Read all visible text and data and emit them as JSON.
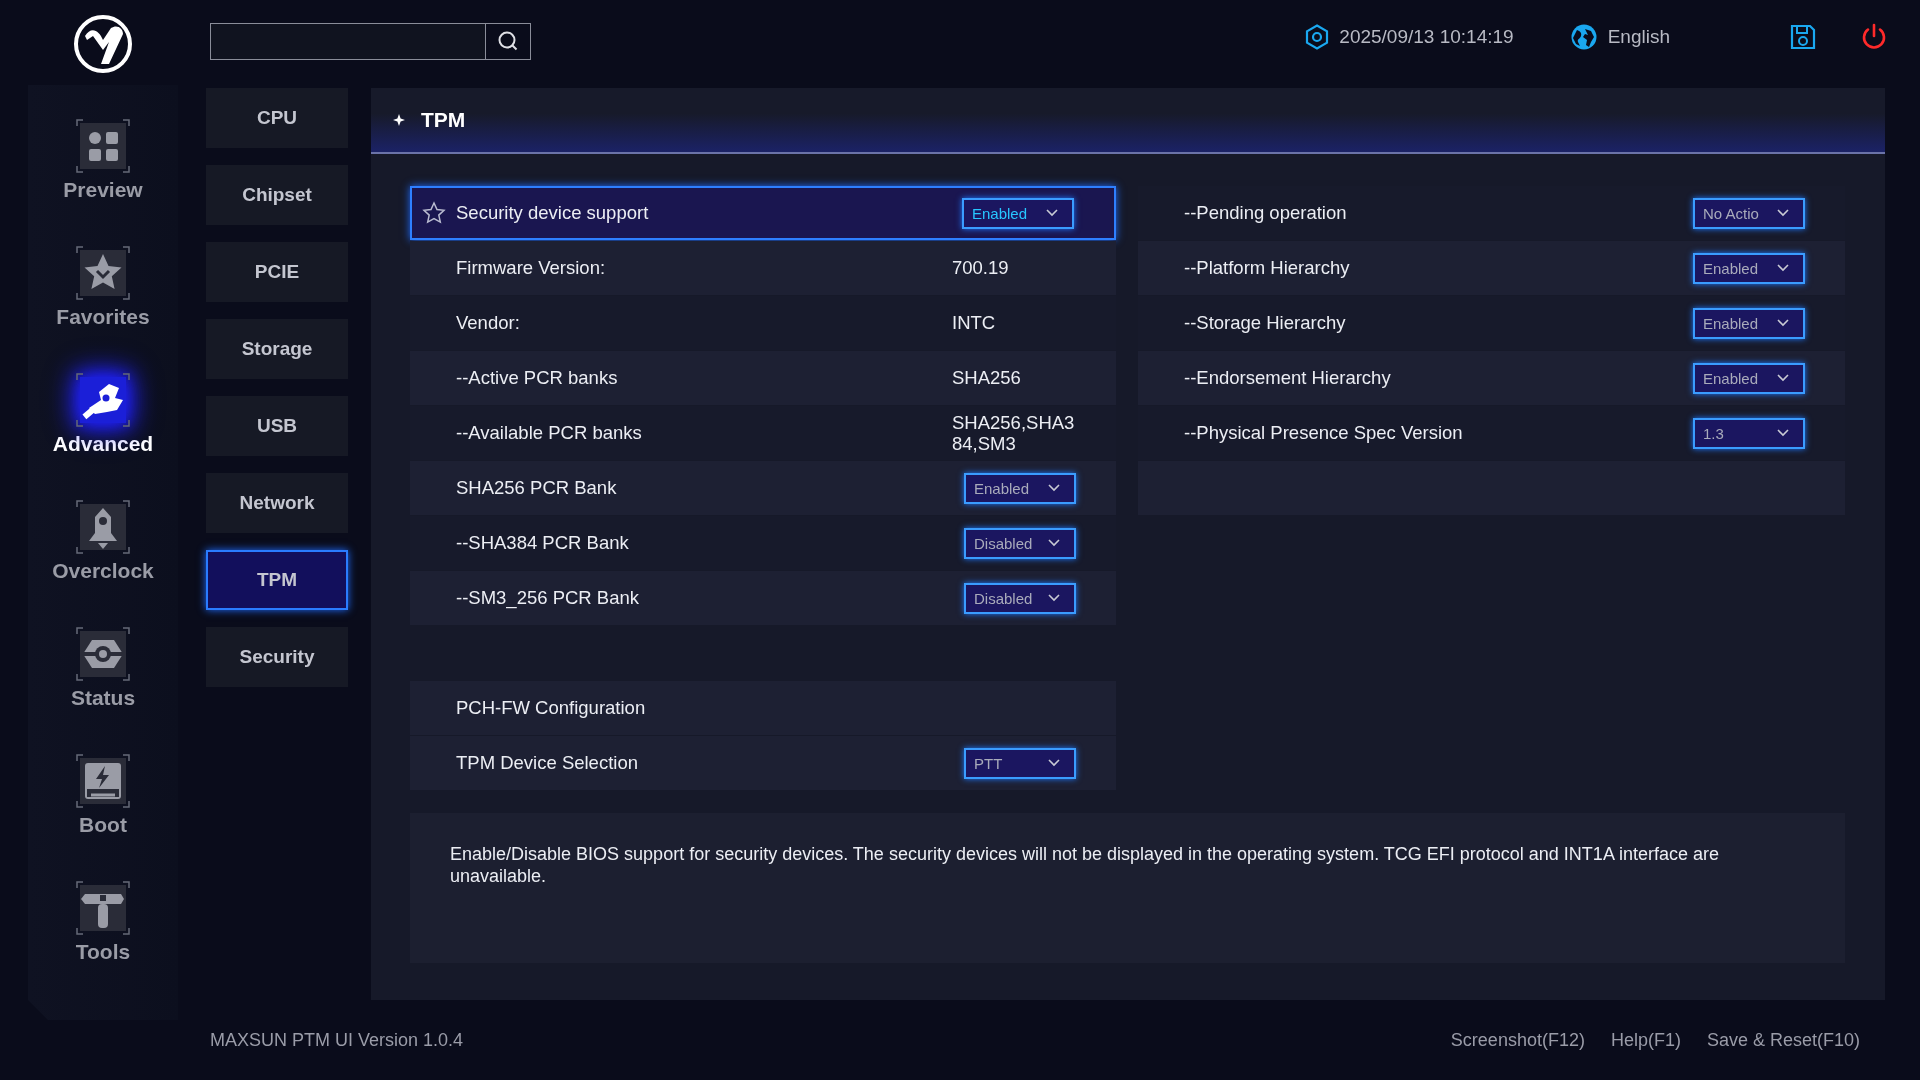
{
  "status_bar": {
    "datetime": "2025/09/13 10:14:19",
    "language": "English"
  },
  "nav": [
    {
      "label": "Preview",
      "selected": false
    },
    {
      "label": "Favorites",
      "selected": false
    },
    {
      "label": "Advanced",
      "selected": true
    },
    {
      "label": "Overclock",
      "selected": false
    },
    {
      "label": "Status",
      "selected": false
    },
    {
      "label": "Boot",
      "selected": false
    },
    {
      "label": "Tools",
      "selected": false
    }
  ],
  "submenu": [
    {
      "label": "CPU",
      "selected": false
    },
    {
      "label": "Chipset",
      "selected": false
    },
    {
      "label": "PCIE",
      "selected": false
    },
    {
      "label": "Storage",
      "selected": false
    },
    {
      "label": "USB",
      "selected": false
    },
    {
      "label": "Network",
      "selected": false
    },
    {
      "label": "TPM",
      "selected": true
    },
    {
      "label": "Security",
      "selected": false
    }
  ],
  "panel": {
    "title": "TPM",
    "left_sections": [
      {
        "rows": [
          {
            "kind": "select",
            "label": "Security device support",
            "value": "Enabled",
            "selected": true
          },
          {
            "kind": "info",
            "label": "Firmware Version:",
            "value": "700.19",
            "selected": false
          },
          {
            "kind": "info",
            "label": "Vendor:",
            "value": "INTC",
            "selected": false
          },
          {
            "kind": "info",
            "label": "--Active PCR banks",
            "value": "SHA256",
            "selected": false
          },
          {
            "kind": "info",
            "label": "--Available PCR banks",
            "value": "SHA256,SHA384,SM3",
            "selected": false
          },
          {
            "kind": "select",
            "label": "SHA256 PCR Bank",
            "value": "Enabled",
            "selected": false
          },
          {
            "kind": "select",
            "label": "--SHA384 PCR Bank",
            "value": "Disabled",
            "selected": false
          },
          {
            "kind": "select",
            "label": "--SM3_256 PCR Bank",
            "value": "Disabled",
            "selected": false
          }
        ]
      },
      {
        "rows": [
          {
            "kind": "heading",
            "label": "PCH-FW Configuration",
            "selected": false
          },
          {
            "kind": "select",
            "label": "TPM Device Selection",
            "value": "PTT",
            "selected": false
          }
        ]
      }
    ],
    "right_rows": [
      {
        "kind": "select",
        "label": "--Pending operation",
        "value": "No Actio",
        "selected": false
      },
      {
        "kind": "select",
        "label": "--Platform Hierarchy",
        "value": "Enabled",
        "selected": false
      },
      {
        "kind": "select",
        "label": "--Storage Hierarchy",
        "value": "Enabled",
        "selected": false
      },
      {
        "kind": "select",
        "label": "--Endorsement Hierarchy",
        "value": "Enabled",
        "selected": false
      },
      {
        "kind": "select",
        "label": "--Physical Presence Spec Version",
        "value": "1.3",
        "selected": false
      }
    ],
    "description": "Enable/Disable BIOS support for security devices. The security devices will not be displayed in the operating system. TCG EFI protocol and INT1A interface are unavailable."
  },
  "footer": {
    "version": "MAXSUN PTM UI Version 1.0.4",
    "shortcuts": [
      "Screenshot(F12)",
      "Help(F1)",
      "Save & Reset(F10)"
    ]
  }
}
